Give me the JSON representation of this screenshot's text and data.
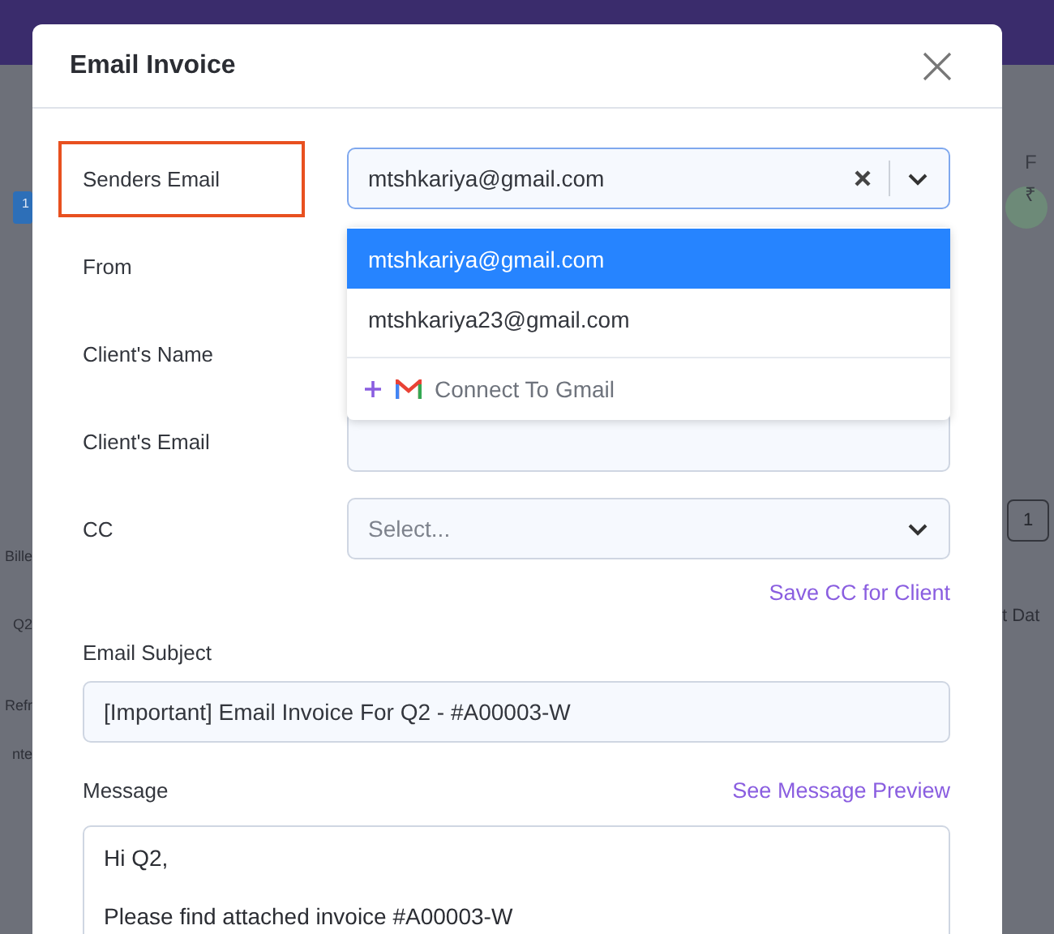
{
  "background": {
    "left_badge": "1",
    "left_texts": [
      "Bille",
      "Q2",
      "Refr",
      "nte"
    ],
    "right_labels": [
      "F",
      "₹"
    ],
    "page_number": "1",
    "column_header": "t Dat"
  },
  "dialog": {
    "title": "Email Invoice",
    "fields": [
      {
        "kind": "select",
        "label": "Senders Email",
        "highlighted": true,
        "value": "mtshkariya@gmail.com",
        "open": true,
        "options": [
          {
            "label": "mtshkariya@gmail.com",
            "selected": true
          },
          {
            "label": "mtshkariya23@gmail.com",
            "selected": false
          }
        ],
        "action": "Connect To Gmail"
      },
      {
        "kind": "text",
        "label": "From",
        "highlighted": false
      },
      {
        "kind": "text",
        "label": "Client's Name",
        "highlighted": false
      },
      {
        "kind": "text",
        "label": "Client's Email",
        "highlighted": false
      },
      {
        "kind": "select",
        "label": "CC",
        "highlighted": false,
        "placeholder": "Select...",
        "open": false
      }
    ],
    "save_cc_link": "Save CC for Client",
    "subject": {
      "label": "Email Subject",
      "value": "[Important] Email Invoice For Q2 - #A00003-W"
    },
    "message": {
      "label": "Message",
      "preview_link": "See Message Preview",
      "lines": [
        "Hi Q2,",
        "Please find attached invoice #A00003-W"
      ]
    }
  }
}
